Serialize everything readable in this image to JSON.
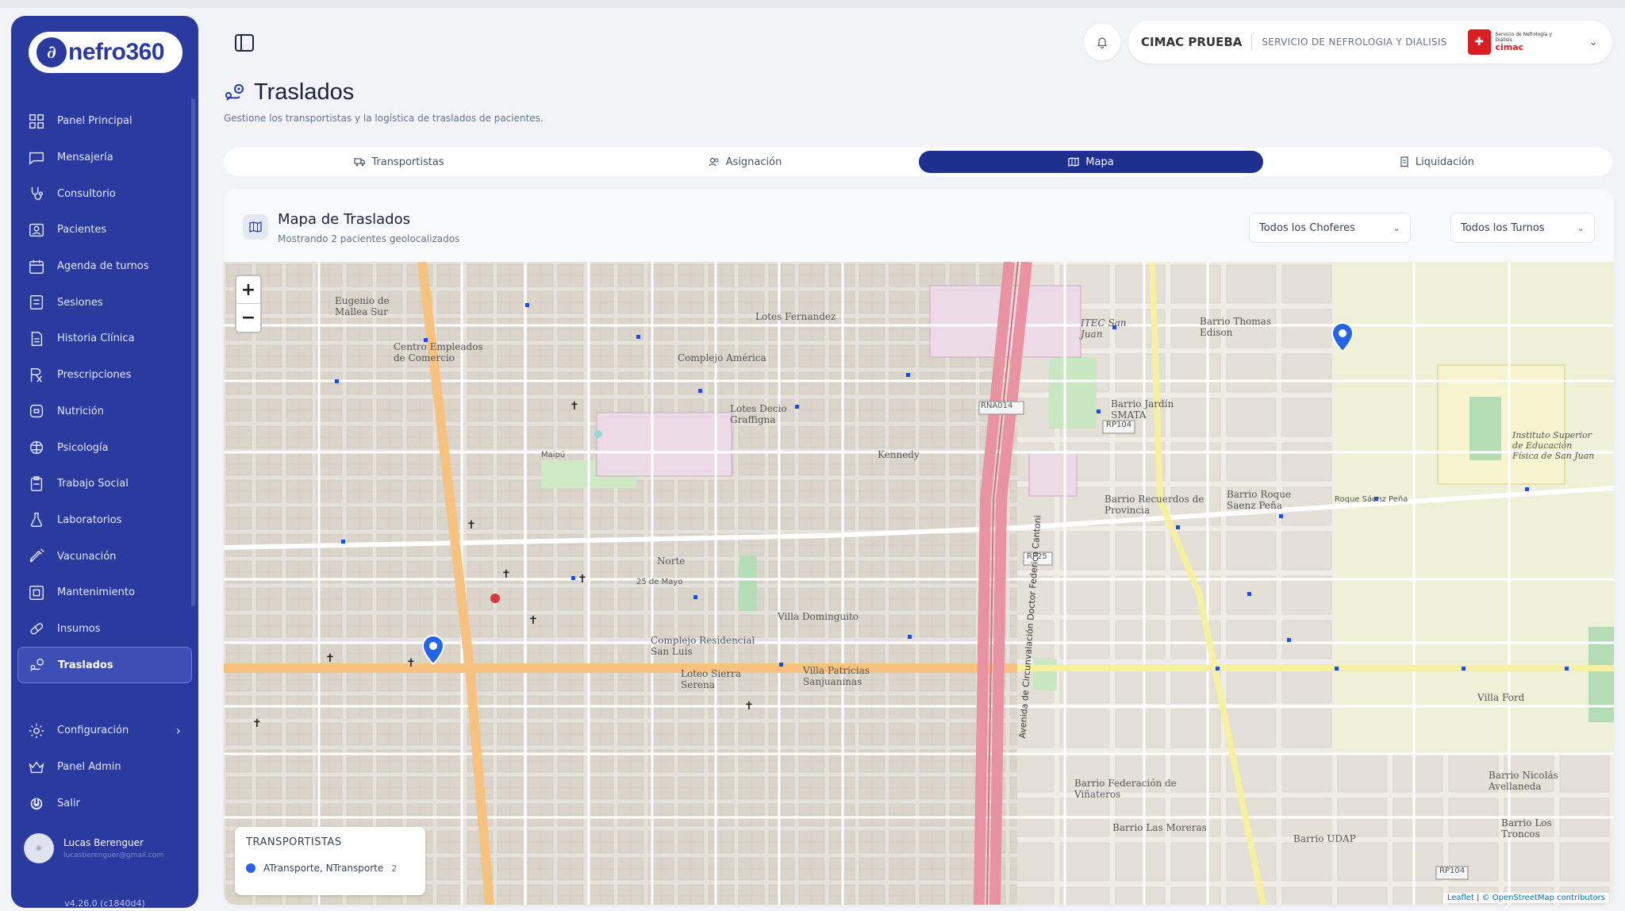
{
  "sidebar": {
    "logo": "nefro360",
    "items": [
      {
        "label": "Panel Principal",
        "icon": "grid-icon"
      },
      {
        "label": "Mensajería",
        "icon": "chat-icon"
      },
      {
        "label": "Consultorio",
        "icon": "stethoscope-icon"
      },
      {
        "label": "Pacientes",
        "icon": "user-card-icon"
      },
      {
        "label": "Agenda de turnos",
        "icon": "calendar-icon"
      },
      {
        "label": "Sesiones",
        "icon": "session-icon"
      },
      {
        "label": "Historia Clínica",
        "icon": "document-icon"
      },
      {
        "label": "Prescripciones",
        "icon": "prescription-icon"
      },
      {
        "label": "Nutrición",
        "icon": "nutrition-icon"
      },
      {
        "label": "Psicología",
        "icon": "brain-icon"
      },
      {
        "label": "Trabajo Social",
        "icon": "clipboard-icon"
      },
      {
        "label": "Laboratorios",
        "icon": "flask-icon"
      },
      {
        "label": "Vacunación",
        "icon": "syringe-icon"
      },
      {
        "label": "Mantenimiento",
        "icon": "maintenance-icon"
      },
      {
        "label": "Insumos",
        "icon": "pill-icon"
      },
      {
        "label": "Traslados",
        "icon": "route-icon",
        "active": true
      }
    ],
    "bottom": [
      {
        "label": "Configuración",
        "icon": "gear-icon"
      },
      {
        "label": "Panel Admin",
        "icon": "crown-icon"
      },
      {
        "label": "Salir",
        "icon": "power-icon"
      }
    ],
    "user": {
      "name": "Lucas Berenguer",
      "email": "lucasberenguer@gmail.com"
    },
    "version": "v4.26.0 (c1840d4)"
  },
  "header": {
    "org_name": "CIMAC PRUEBA",
    "org_sub": "SERVICIO DE NEFROLOGIA Y DIALISIS",
    "org_logo_small": "Servicio de Nefrología y Diálisis",
    "org_logo_brand": "cimac"
  },
  "page": {
    "title": "Traslados",
    "subtitle": "Gestione los transportistas y la logística de traslados de pacientes."
  },
  "tabs": [
    {
      "label": "Transportistas",
      "icon": "truck-icon"
    },
    {
      "label": "Asignación",
      "icon": "users-icon"
    },
    {
      "label": "Mapa",
      "icon": "map-icon",
      "active": true
    },
    {
      "label": "Liquidación",
      "icon": "receipt-icon"
    }
  ],
  "map_card": {
    "title": "Mapa de Traslados",
    "subtitle": "Mostrando 2 pacientes geolocalizados",
    "filter_drivers": "Todos los Choferes",
    "filter_shifts": "Todos los Turnos",
    "zoom_in": "+",
    "zoom_out": "−",
    "legend_title": "TRANSPORTISTAS",
    "legend_entry": "ATransporte, NTransporte",
    "legend_count": "2",
    "legend_color": "#2563eb",
    "attribution_leaflet": "Leaflet",
    "attribution_osm": "© OpenStreetMap contributors",
    "labels": {
      "l1": "Eugenio de Mallea Sur",
      "l2": "Centro Empleados de Comercio",
      "l3": "Complejo América",
      "l4": "Lotes Fernandez",
      "l5": "Lotes Decio Graffigna",
      "l6": "Kennedy",
      "l7": "Norte",
      "l8": "Villa Dominguito",
      "l9": "Complejo Residencial San Luis",
      "l10": "Loteo Sierra Serena",
      "l11": "Villa Patricias Sanjuaninas",
      "l12": "ITEC San Juan",
      "l13": "Barrio Thomas Edison",
      "l14": "Barrio Jardín SMATA",
      "l15": "Barrio Recuerdos de Provincia",
      "l16": "Barrio Roque Saenz Peña",
      "l17": "Instituto Superior de Educación Física de San Juan",
      "l18": "Villa Ford",
      "l19": "Barrio Federación de Viñateros",
      "l20": "Barrio Las Moreras",
      "l21": "Barrio UDAP",
      "l22": "Barrio Nicolás Avellaneda",
      "l23": "Barrio Los Troncos",
      "l24": "RNA014",
      "l25": "RP104",
      "l26": "RP25",
      "l27": "Avenida de Circunvalación Doctor Federico Cantoni",
      "l28": "Maipú",
      "l29": "25 de Mayo",
      "l30": "Roque Sáenz Peña"
    }
  }
}
